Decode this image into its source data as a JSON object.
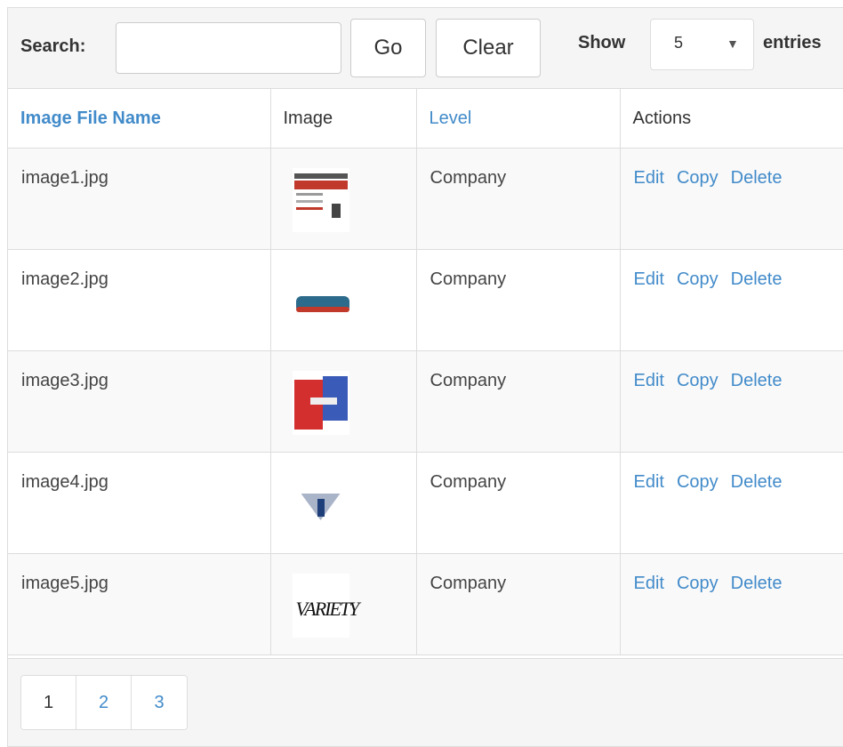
{
  "toolbar": {
    "search_label": "Search:",
    "search_value": "",
    "search_placeholder": "",
    "go_label": "Go",
    "clear_label": "Clear",
    "show_label": "Show",
    "page_size": "5",
    "entries_label": "entries"
  },
  "table": {
    "headers": {
      "file_name": "Image File Name",
      "image": "Image",
      "level": "Level",
      "actions": "Actions"
    },
    "rows": [
      {
        "file_name": "image1.jpg",
        "level": "Company",
        "thumbnail": "webpage-screenshot-thumbnail"
      },
      {
        "file_name": "image2.jpg",
        "level": "Company",
        "thumbnail": "script-logo-thumbnail"
      },
      {
        "file_name": "image3.jpg",
        "level": "Company",
        "thumbnail": "red-blue-logo-thumbnail"
      },
      {
        "file_name": "image4.jpg",
        "level": "Company",
        "thumbnail": "shield-logo-thumbnail"
      },
      {
        "file_name": "image5.jpg",
        "level": "Company",
        "thumbnail": "variety-logo-thumbnail"
      }
    ],
    "actions": {
      "edit": "Edit",
      "copy": "Copy",
      "delete": "Delete"
    }
  },
  "pagination": {
    "pages": [
      "1",
      "2",
      "3"
    ],
    "active": "1"
  },
  "colors": {
    "link": "#428bca",
    "toolbar_bg": "#f5f5f5",
    "stripe_bg": "#f9f9f9",
    "border": "#dddddd"
  }
}
